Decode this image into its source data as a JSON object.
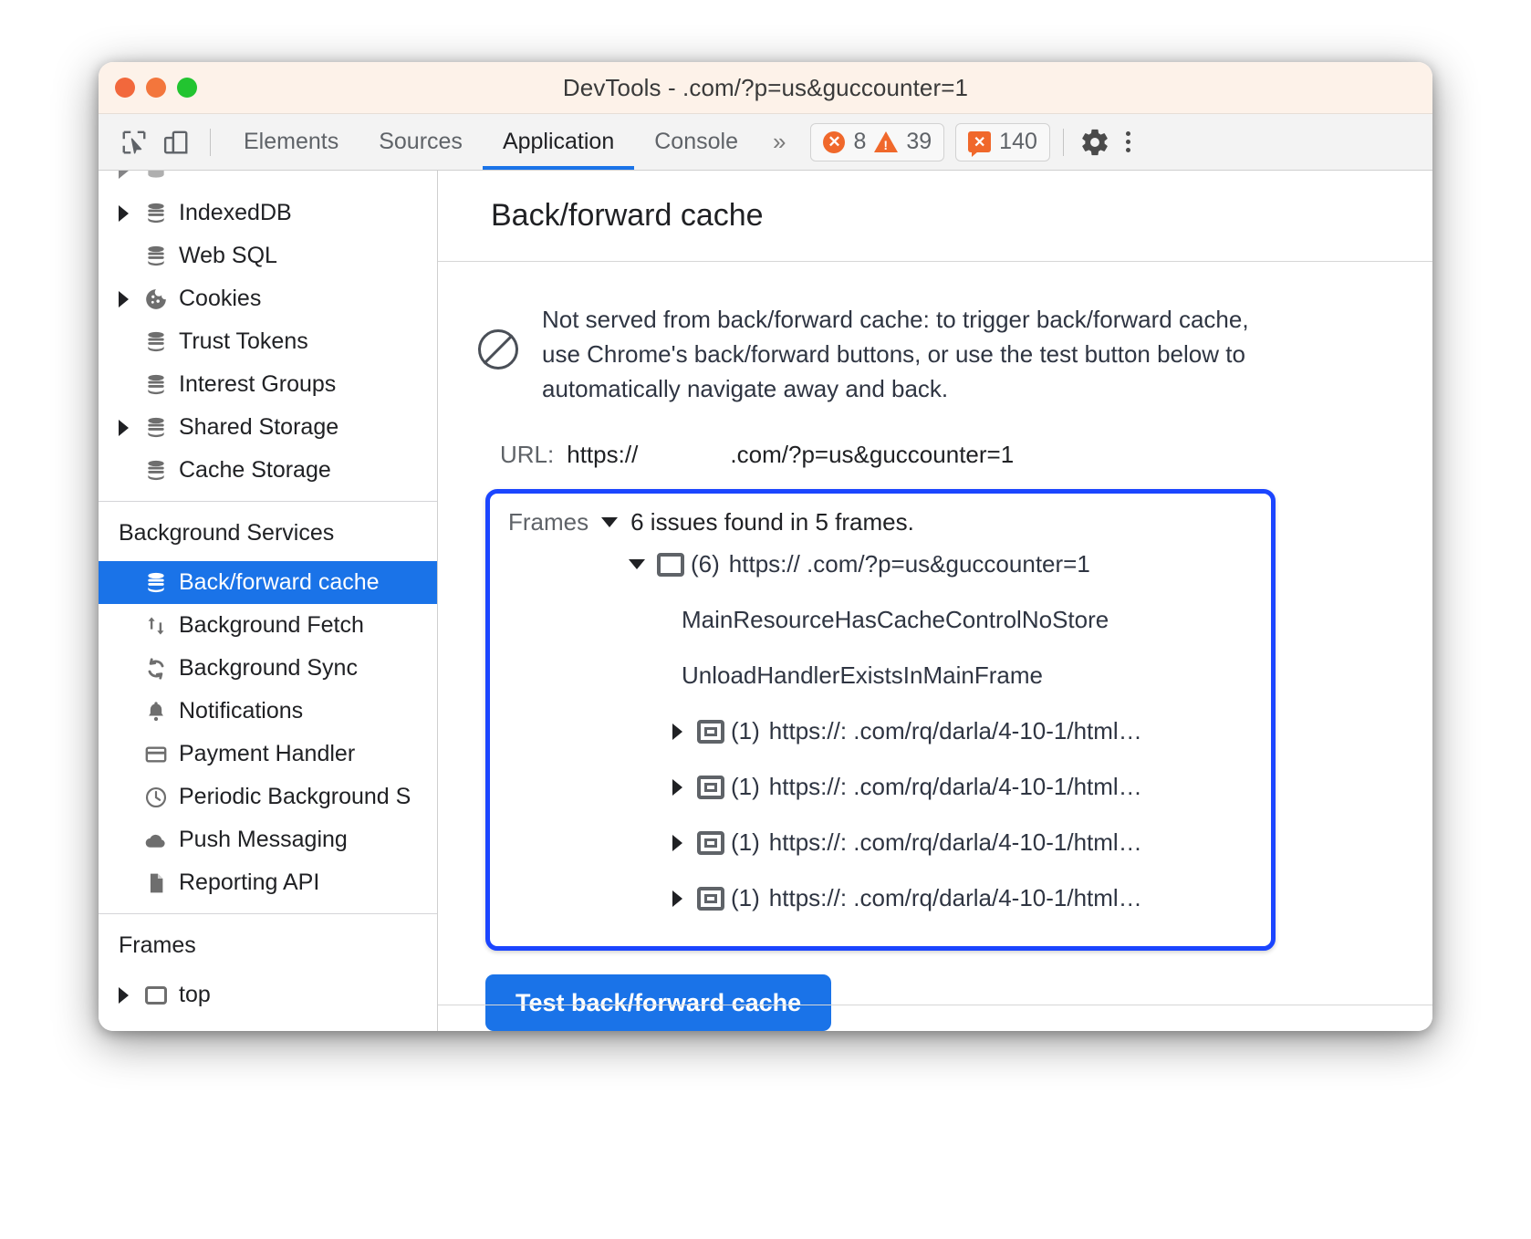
{
  "window": {
    "title": "DevTools -            .com/?p=us&guccounter=1"
  },
  "toolbar": {
    "inspect_icon": "inspect-cursor-icon",
    "device_icon": "device-toolbar-icon",
    "tabs": [
      {
        "label": "Elements",
        "active": false
      },
      {
        "label": "Sources",
        "active": false
      },
      {
        "label": "Application",
        "active": true
      },
      {
        "label": "Console",
        "active": false
      }
    ],
    "more_tabs_label": "»",
    "errors_count": "8",
    "warnings_count": "39",
    "issues_count": "140",
    "settings_icon": "gear-icon",
    "menu_icon": "kebab-menu-icon",
    "accent": "#1a73e8",
    "badge_color": "#f0682b"
  },
  "sidebar": {
    "storage_items": [
      {
        "label": "IndexedDB",
        "icon": "database-icon",
        "expandable": true
      },
      {
        "label": "Web SQL",
        "icon": "database-icon",
        "expandable": false
      },
      {
        "label": "Cookies",
        "icon": "cookie-icon",
        "expandable": true
      },
      {
        "label": "Trust Tokens",
        "icon": "database-icon",
        "expandable": false
      },
      {
        "label": "Interest Groups",
        "icon": "database-icon",
        "expandable": false
      },
      {
        "label": "Shared Storage",
        "icon": "database-icon",
        "expandable": true
      },
      {
        "label": "Cache Storage",
        "icon": "database-icon",
        "expandable": false
      }
    ],
    "background_services_title": "Background Services",
    "background_items": [
      {
        "label": "Back/forward cache",
        "icon": "database-icon",
        "selected": true
      },
      {
        "label": "Background Fetch",
        "icon": "arrows-up-down-icon",
        "selected": false
      },
      {
        "label": "Background Sync",
        "icon": "sync-icon",
        "selected": false
      },
      {
        "label": "Notifications",
        "icon": "bell-icon",
        "selected": false
      },
      {
        "label": "Payment Handler",
        "icon": "credit-card-icon",
        "selected": false
      },
      {
        "label": "Periodic Background S",
        "icon": "clock-icon",
        "selected": false
      },
      {
        "label": "Push Messaging",
        "icon": "cloud-icon",
        "selected": false
      },
      {
        "label": "Reporting API",
        "icon": "document-icon",
        "selected": false
      }
    ],
    "frames_title": "Frames",
    "frames_items": [
      {
        "label": "top",
        "icon": "frame-icon",
        "expandable": true
      }
    ]
  },
  "main": {
    "panel_title": "Back/forward cache",
    "status_icon": "no-entry-icon",
    "status_message": "Not served from back/forward cache: to trigger back/forward cache, use Chrome's back/forward buttons, or use the test button below to automatically navigate away and back.",
    "url_label": "URL:",
    "url_value": "https://              .com/?p=us&guccounter=1",
    "frames_panel": {
      "label": "Frames",
      "summary": "6 issues found in 5 frames.",
      "expanded": true,
      "highlight_color": "#1b45ff",
      "tree": [
        {
          "count": "(6)",
          "url": "https://                 .com/?p=us&guccounter=1",
          "icon": "frame-icon",
          "expanded": true,
          "reasons": [
            "MainResourceHasCacheControlNoStore",
            "UnloadHandlerExistsInMainFrame"
          ]
        },
        {
          "count": "(1)",
          "url": "https://:            .com/rq/darla/4-10-1/html…",
          "icon": "iframe-icon",
          "expanded": false,
          "reasons": []
        },
        {
          "count": "(1)",
          "url": "https://:            .com/rq/darla/4-10-1/html…",
          "icon": "iframe-icon",
          "expanded": false,
          "reasons": []
        },
        {
          "count": "(1)",
          "url": "https://:            .com/rq/darla/4-10-1/html…",
          "icon": "iframe-icon",
          "expanded": false,
          "reasons": []
        },
        {
          "count": "(1)",
          "url": "https://:            .com/rq/darla/4-10-1/html…",
          "icon": "iframe-icon",
          "expanded": false,
          "reasons": []
        }
      ]
    },
    "test_button_label": "Test back/forward cache"
  }
}
